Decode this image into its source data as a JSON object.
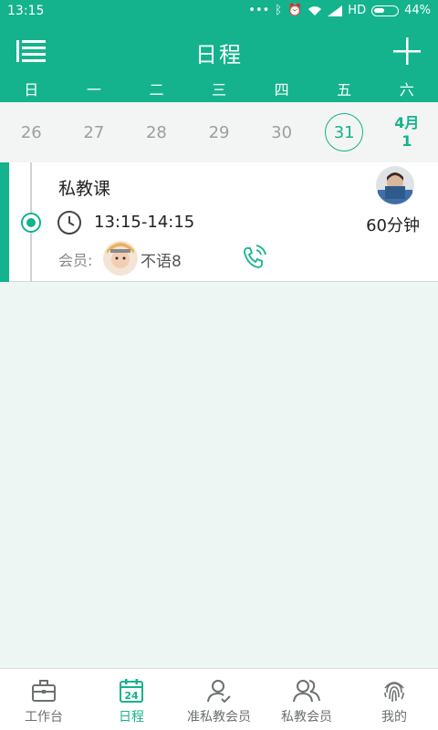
{
  "status_bar": {
    "time": "13:15",
    "network": "HD",
    "battery": "44%"
  },
  "header": {
    "title": "日程"
  },
  "weekdays": [
    "日",
    "一",
    "二",
    "三",
    "四",
    "五",
    "六"
  ],
  "dates": {
    "d0": "26",
    "d1": "27",
    "d2": "28",
    "d3": "29",
    "d4": "30",
    "selected": "31",
    "next_month": "4月",
    "next_day": "1"
  },
  "schedule": {
    "course_title": "私教课",
    "time_range": "13:15-14:15",
    "duration": "60分钟",
    "member_label": "会员:",
    "member_name": "不语8"
  },
  "bottom_nav": [
    {
      "label": "工作台",
      "icon": "briefcase-icon"
    },
    {
      "label": "日程",
      "icon": "calendar-icon"
    },
    {
      "label": "准私教会员",
      "icon": "user-check-icon"
    },
    {
      "label": "私教会员",
      "icon": "users-icon"
    },
    {
      "label": "我的",
      "icon": "fingerprint-icon"
    }
  ],
  "colors": {
    "accent": "#14b38d",
    "background": "#eef6f4"
  }
}
